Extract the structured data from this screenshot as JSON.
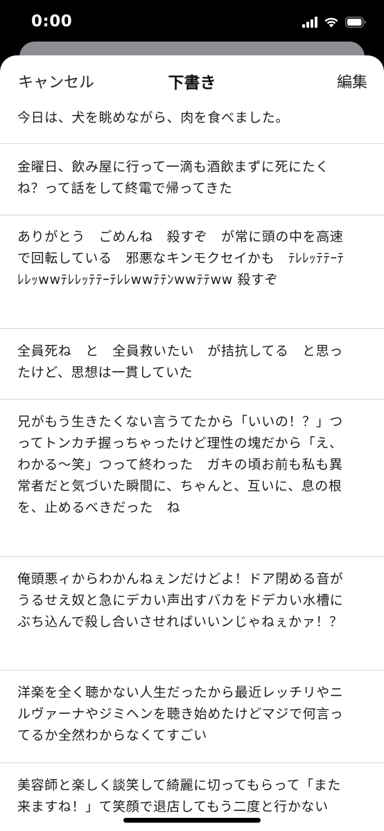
{
  "status_bar": {
    "time": "0:00"
  },
  "nav": {
    "cancel_label": "キャンセル",
    "title": "下書き",
    "edit_label": "編集"
  },
  "drafts": [
    "今日は、犬を眺めながら、肉を食べました。",
    "金曜日、飲み屋に行って一滴も酒飲まずに死にたく\nね？って話をして終電で帰ってきた",
    "ありがとう　ごめんね　殺すぞ　が常に頭の中を高速\nで回転している　邪悪なキンモクセイかも　ﾃﾚﾚｯﾃﾃｰﾃ\nﾚﾚｯwwﾃﾚﾚｯﾃﾃｰﾃﾚﾚwwﾃﾃﾝwwﾃﾃww 殺すぞ",
    "全員死ね　と　全員救いたい　が拮抗してる　と思っ\nたけど、思想は一貫していた",
    "兄がもう生きたくない言うてたから「いいの！？」つ\nってトンカチ握っちゃったけど理性の塊だから「え、\nわかる〜笑」つって終わった　ガキの頃お前も私も異\n常者だと気づいた瞬間に、ちゃんと、互いに、息の根\nを、止めるべきだった　ね",
    "俺頭悪ィからわかんねぇンだけどよ！ドア閉める音が\nうるせえ奴と急にデカい声出すバカをドデカい水槽に\nぶち込んで殺し合いさせればいいンじゃねぇかァ！？",
    "洋楽を全く聴かない人生だったから最近レッチリやニ\nルヴァーナやジミヘンを聴き始めたけどマジで何言っ\nてるか全然わからなくてすごい",
    "美容師と楽しく談笑して綺麗に切ってもらって「また\n来ますね！」て笑顔で退店してもう二度と行かない"
  ]
}
